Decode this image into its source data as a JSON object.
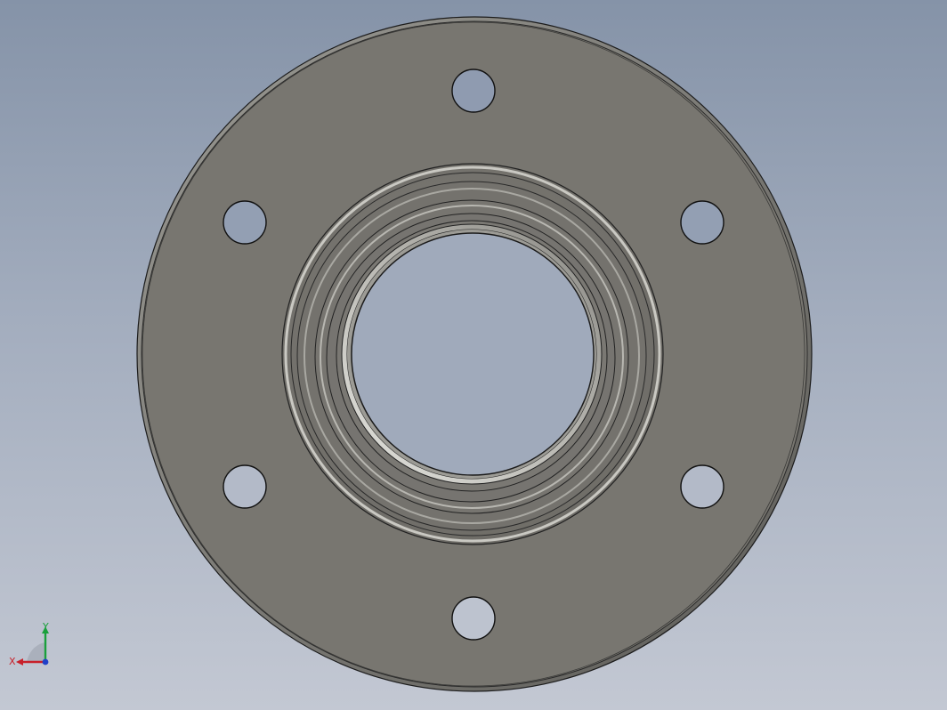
{
  "viewport": {
    "background_top": "#8593a8",
    "background_bottom": "#c3c8d3"
  },
  "model": {
    "part": "flange",
    "face_color": "#787670",
    "edge_color": "#1c1c1c",
    "bore_highlight_color": "#d2d2cc",
    "bolt_hole_count": 6
  },
  "triad": {
    "x_label": "X",
    "y_label": "Y",
    "x_color": "#c8202a",
    "y_color": "#1aa03c",
    "z_color": "#2040c8"
  }
}
